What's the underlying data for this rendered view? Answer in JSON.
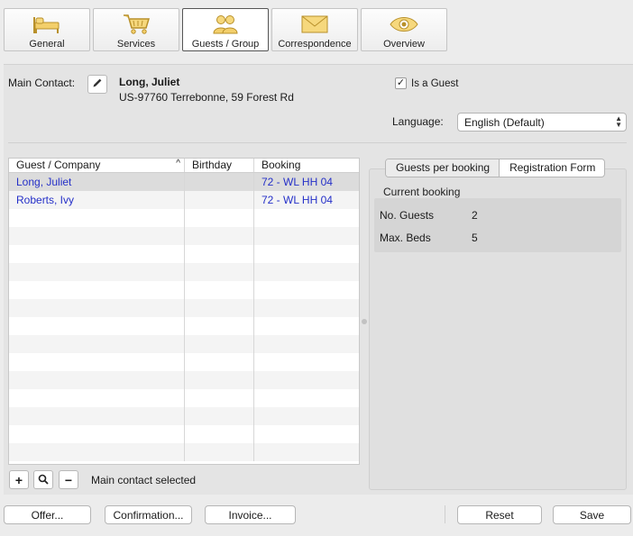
{
  "tabs": [
    {
      "label": "General",
      "icon": "bed-icon"
    },
    {
      "label": "Services",
      "icon": "shopping-cart-icon"
    },
    {
      "label": "Guests / Group",
      "icon": "guests-group-icon",
      "active": true
    },
    {
      "label": "Correspondence",
      "icon": "envelope-icon"
    },
    {
      "label": "Overview",
      "icon": "eye-icon"
    }
  ],
  "contact": {
    "label": "Main Contact:",
    "name": "Long, Juliet",
    "address": "US-97760 Terrebonne, 59 Forest Rd",
    "is_guest_label": "Is a Guest",
    "is_guest_checked": true,
    "check_mark": "✓"
  },
  "language": {
    "label": "Language:",
    "value": "English (Default)"
  },
  "guest_table": {
    "columns": [
      "Guest / Company",
      "Birthday",
      "Booking"
    ],
    "sort_indicator": "^",
    "rows": [
      {
        "guest": "Long, Juliet",
        "birthday": "",
        "booking": "72 - WL HH 04",
        "selected": true
      },
      {
        "guest": "Roberts, Ivy",
        "birthday": "",
        "booking": "72 - WL HH 04",
        "selected": false
      }
    ]
  },
  "table_buttons": {
    "add": "+",
    "remove": "−"
  },
  "status": "Main contact selected",
  "right_panel": {
    "tabs": [
      "Guests per booking",
      "Registration Form"
    ],
    "current_booking_label": "Current booking",
    "no_guests_label": "No. Guests",
    "no_guests_value": "2",
    "max_beds_label": "Max. Beds",
    "max_beds_value": "5"
  },
  "bottom_buttons": {
    "offer": "Offer...",
    "confirmation": "Confirmation...",
    "invoice": "Invoice...",
    "reset": "Reset",
    "save": "Save"
  },
  "colors": {
    "accent_icon": "#e8b94a",
    "link_text": "#2530c8"
  }
}
